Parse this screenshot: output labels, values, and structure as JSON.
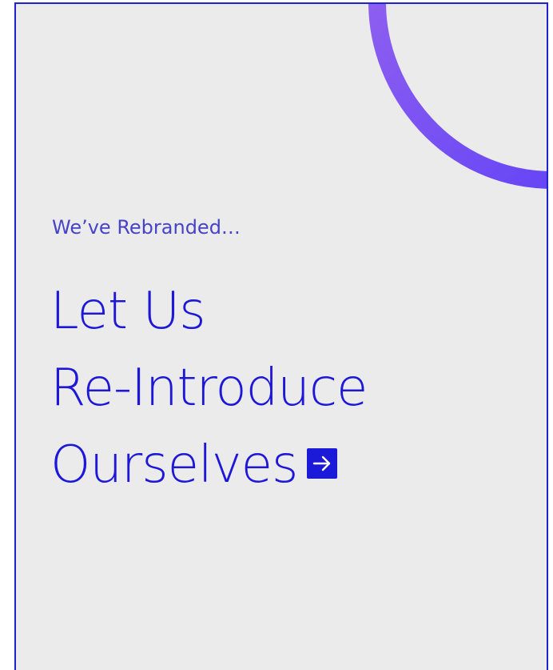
{
  "promo": {
    "eyebrow": "We’ve Rebranded…",
    "headline_lines": [
      "Let Us",
      "Re-Introduce",
      "Ourselves"
    ]
  },
  "icons": {
    "arrow": "arrow-right-icon",
    "arc": "decorative-arc-icon"
  },
  "colors": {
    "background": "#ecebec",
    "border": "#1f22d3",
    "text": "#1d18d8",
    "eyebrow": "#4643c8",
    "arc_start": "#8a5cf0",
    "arc_end": "#6a46f4",
    "button": "#1a1ad8"
  }
}
